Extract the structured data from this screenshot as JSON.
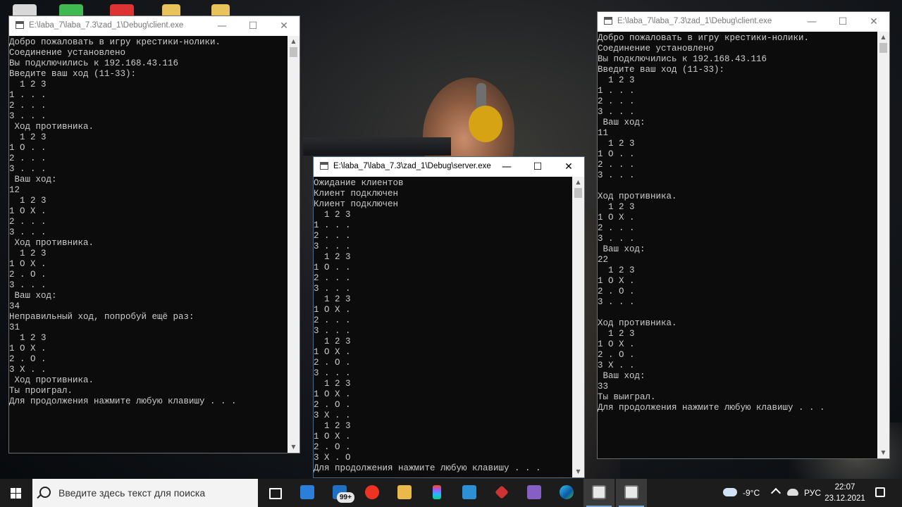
{
  "windows": {
    "client_left": {
      "title": "E:\\laba_7\\laba_7.3\\zad_1\\Debug\\client.exe",
      "lines": [
        "Добро пожаловать в игру крестики-нолики.",
        "Соединение установлено",
        "Вы подключились к 192.168.43.116",
        "Введите ваш ход (11-33):",
        "  1 2 3",
        "1 . . .",
        "2 . . .",
        "3 . . .",
        " Ход противника.",
        "  1 2 3",
        "1 O . .",
        "2 . . .",
        "3 . . .",
        " Ваш ход:",
        "12",
        "  1 2 3",
        "1 O X .",
        "2 . . .",
        "3 . . .",
        " Ход противника.",
        "  1 2 3",
        "1 O X .",
        "2 . O .",
        "3 . . .",
        " Ваш ход:",
        "34",
        "Неправильный ход, попробуй ещё раз:",
        "31",
        "  1 2 3",
        "1 O X .",
        "2 . O .",
        "3 X . .",
        " Ход противника.",
        "Ты проиграл.",
        "Для продолжения нажмите любую клавишу . . ."
      ]
    },
    "server": {
      "title": "E:\\laba_7\\laba_7.3\\zad_1\\Debug\\server.exe",
      "lines": [
        "Ожидание клиентов",
        "Клиент подключен",
        "Клиент подключен",
        "  1 2 3",
        "1 . . .",
        "2 . . .",
        "3 . . .",
        "  1 2 3",
        "1 O . .",
        "2 . . .",
        "3 . . .",
        "  1 2 3",
        "1 O X .",
        "2 . . .",
        "3 . . .",
        "  1 2 3",
        "1 O X .",
        "2 . O .",
        "3 . . .",
        "  1 2 3",
        "1 O X .",
        "2 . O .",
        "3 X . .",
        "  1 2 3",
        "1 O X .",
        "2 . O .",
        "3 X . O",
        "Для продолжения нажмите любую клавишу . . ."
      ]
    },
    "client_right": {
      "title": "E:\\laba_7\\laba_7.3\\zad_1\\Debug\\client.exe",
      "lines": [
        "Добро пожаловать в игру крестики-нолики.",
        "Соединение установлено",
        "Вы подключились к 192.168.43.116",
        "Введите ваш ход (11-33):",
        "  1 2 3",
        "1 . . .",
        "2 . . .",
        "3 . . .",
        " Ваш ход:",
        "11",
        "  1 2 3",
        "1 O . .",
        "2 . . .",
        "3 . . .",
        "",
        "Ход противника.",
        "  1 2 3",
        "1 O X .",
        "2 . . .",
        "3 . . .",
        " Ваш ход:",
        "22",
        "  1 2 3",
        "1 O X .",
        "2 . O .",
        "3 . . .",
        "",
        "Ход противника.",
        "  1 2 3",
        "1 O X .",
        "2 . O .",
        "3 X . .",
        " Ваш ход:",
        "33",
        "Ты выиграл.",
        "Для продолжения нажмите любую клавишу . . ."
      ]
    },
    "controls": {
      "minimize": "—",
      "maximize": "☐",
      "close": "✕"
    }
  },
  "taskbar": {
    "search_placeholder": "Введите здесь текст для поиска",
    "mail_badge": "99+",
    "weather": "-9°C",
    "language": "РУС",
    "time": "22:07",
    "date": "23.12.2021",
    "icons": [
      "windows-start-icon",
      "task-view-icon",
      "store-icon",
      "mail-icon",
      "yandex-browser-icon",
      "file-explorer-icon",
      "figma-icon",
      "blue-app-icon",
      "compass-app-icon",
      "visual-studio-icon",
      "edge-icon",
      "console-window-icon",
      "console-window-icon"
    ]
  },
  "colors": {
    "console_bg": "#0c0c0c",
    "console_fg": "#cccccc",
    "taskbar_bg": "#1c1c1c"
  }
}
